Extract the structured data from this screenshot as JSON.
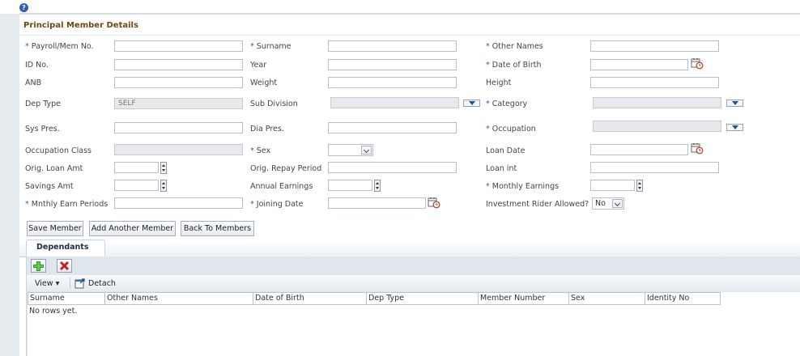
{
  "help_glyph": "?",
  "section_title": "Principal Member Details",
  "form": {
    "payroll_label": "Payroll/Mem No.",
    "surname_label": "Surname",
    "other_names_label": "Other Names",
    "id_no_label": "ID No.",
    "year_label": "Year",
    "dob_label": "Date of Birth",
    "anb_label": "ANB",
    "weight_label": "Weight",
    "height_label": "Height",
    "dep_type_label": "Dep Type",
    "dep_type_value": "SELF",
    "sub_division_label": "Sub Division",
    "category_label": "Category",
    "sys_pres_label": "Sys Pres.",
    "dia_pres_label": "Dia Pres.",
    "occupation_label": "Occupation",
    "occupation_class_label": "Occupation Class",
    "sex_label": "Sex",
    "loan_date_label": "Loan Date",
    "orig_loan_amt_label": "Orig. Loan Amt",
    "orig_repay_period_label": "Orig. Repay Period",
    "loan_int_label": "Loan int",
    "savings_amt_label": "Savings Amt",
    "annual_earnings_label": "Annual Earnings",
    "monthly_earnings_label": "Monthly Earnings",
    "mnthly_earn_periods_label": "Mnthly Earn Periods",
    "joining_date_label": "Joining Date",
    "investment_rider_label": "Investment Rider Allowed?",
    "investment_rider_value": "No",
    "required_marker": "*"
  },
  "buttons": {
    "save_member": "Save Member",
    "add_another_member": "Add Another Member",
    "back_to_members": "Back To Members"
  },
  "dependants": {
    "tab_label": "Dependants",
    "view_label": "View ▾",
    "detach_label": "Detach",
    "columns": [
      "Surname",
      "Other Names",
      "Date of Birth",
      "Dep Type",
      "Member Number",
      "Sex",
      "Identity No"
    ],
    "empty_text": "No rows yet."
  }
}
